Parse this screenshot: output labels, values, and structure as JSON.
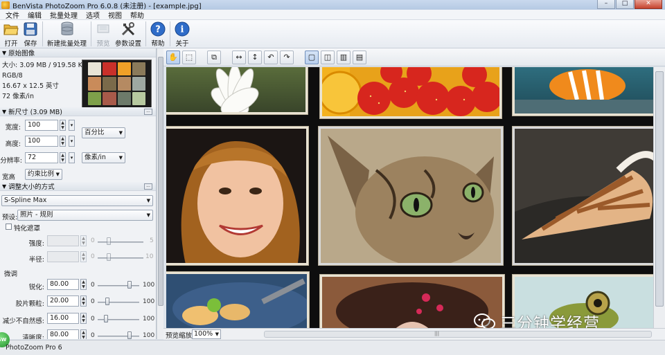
{
  "window": {
    "title": "BenVista PhotoZoom Pro 6.0.8 (未注册) - [example.jpg]",
    "controls": {
      "minimize": "–",
      "maximize": "□",
      "close": "✕"
    }
  },
  "menu": [
    "文件",
    "编辑",
    "批量处理",
    "选项",
    "视图",
    "帮助"
  ],
  "toolbar": {
    "open": "打开",
    "save": "保存",
    "new_batch": "新建批量处理",
    "preview": "预览",
    "params": "参数设置",
    "help": "帮助",
    "about": "关于"
  },
  "original": {
    "heading": "原始图像",
    "size": "大小: 3.09 MB / 919.58 KB",
    "mode": "RGB/8",
    "dimensions": "16.67 x 12.5 英寸",
    "resolution": "72 像素/in"
  },
  "new_size": {
    "heading": "新尺寸 (3.09 MB)",
    "width_label": "宽度:",
    "width_value": "100",
    "height_label": "高度:",
    "height_value": "100",
    "unit": "百分比",
    "resolution_label": "分辨率:",
    "resolution_value": "72",
    "resolution_unit": "像素/in",
    "aspect_label": "宽高比:",
    "aspect_value": "约束比例"
  },
  "resize_method": {
    "heading": "调整大小的方式",
    "method": "S-Spline Max",
    "preset_label": "预设:",
    "preset": "照片 - 规则"
  },
  "unsharp": {
    "heading": "钝化遮罩",
    "amount_label": "强度:",
    "amount_min": "0",
    "amount_max": "5",
    "radius_label": "半径:",
    "radius_min": "0",
    "radius_max": "10"
  },
  "finetune": {
    "heading": "微调",
    "sharpness_label": "锐化:",
    "sharpness_value": "80.00",
    "sharpness_level": 0.8,
    "film_grain_label": "胶片颗粒:",
    "film_grain_value": "20.00",
    "film_grain_level": 0.2,
    "artifact_label": "减少不自然感:",
    "artifact_value": "16.00",
    "artifact_level": 0.16,
    "clarity_label": "清晰度:",
    "clarity_value": "80.00",
    "clarity_level": 0.8,
    "min": "0",
    "max": "100"
  },
  "bottom": {
    "zoom_label": "预览缩放:",
    "zoom_value": "100%",
    "grip": "|||"
  },
  "status": {
    "text": "PhotoZoom Pro 6",
    "badge": "SW"
  },
  "watermark": {
    "text": "三分钟学经营"
  }
}
